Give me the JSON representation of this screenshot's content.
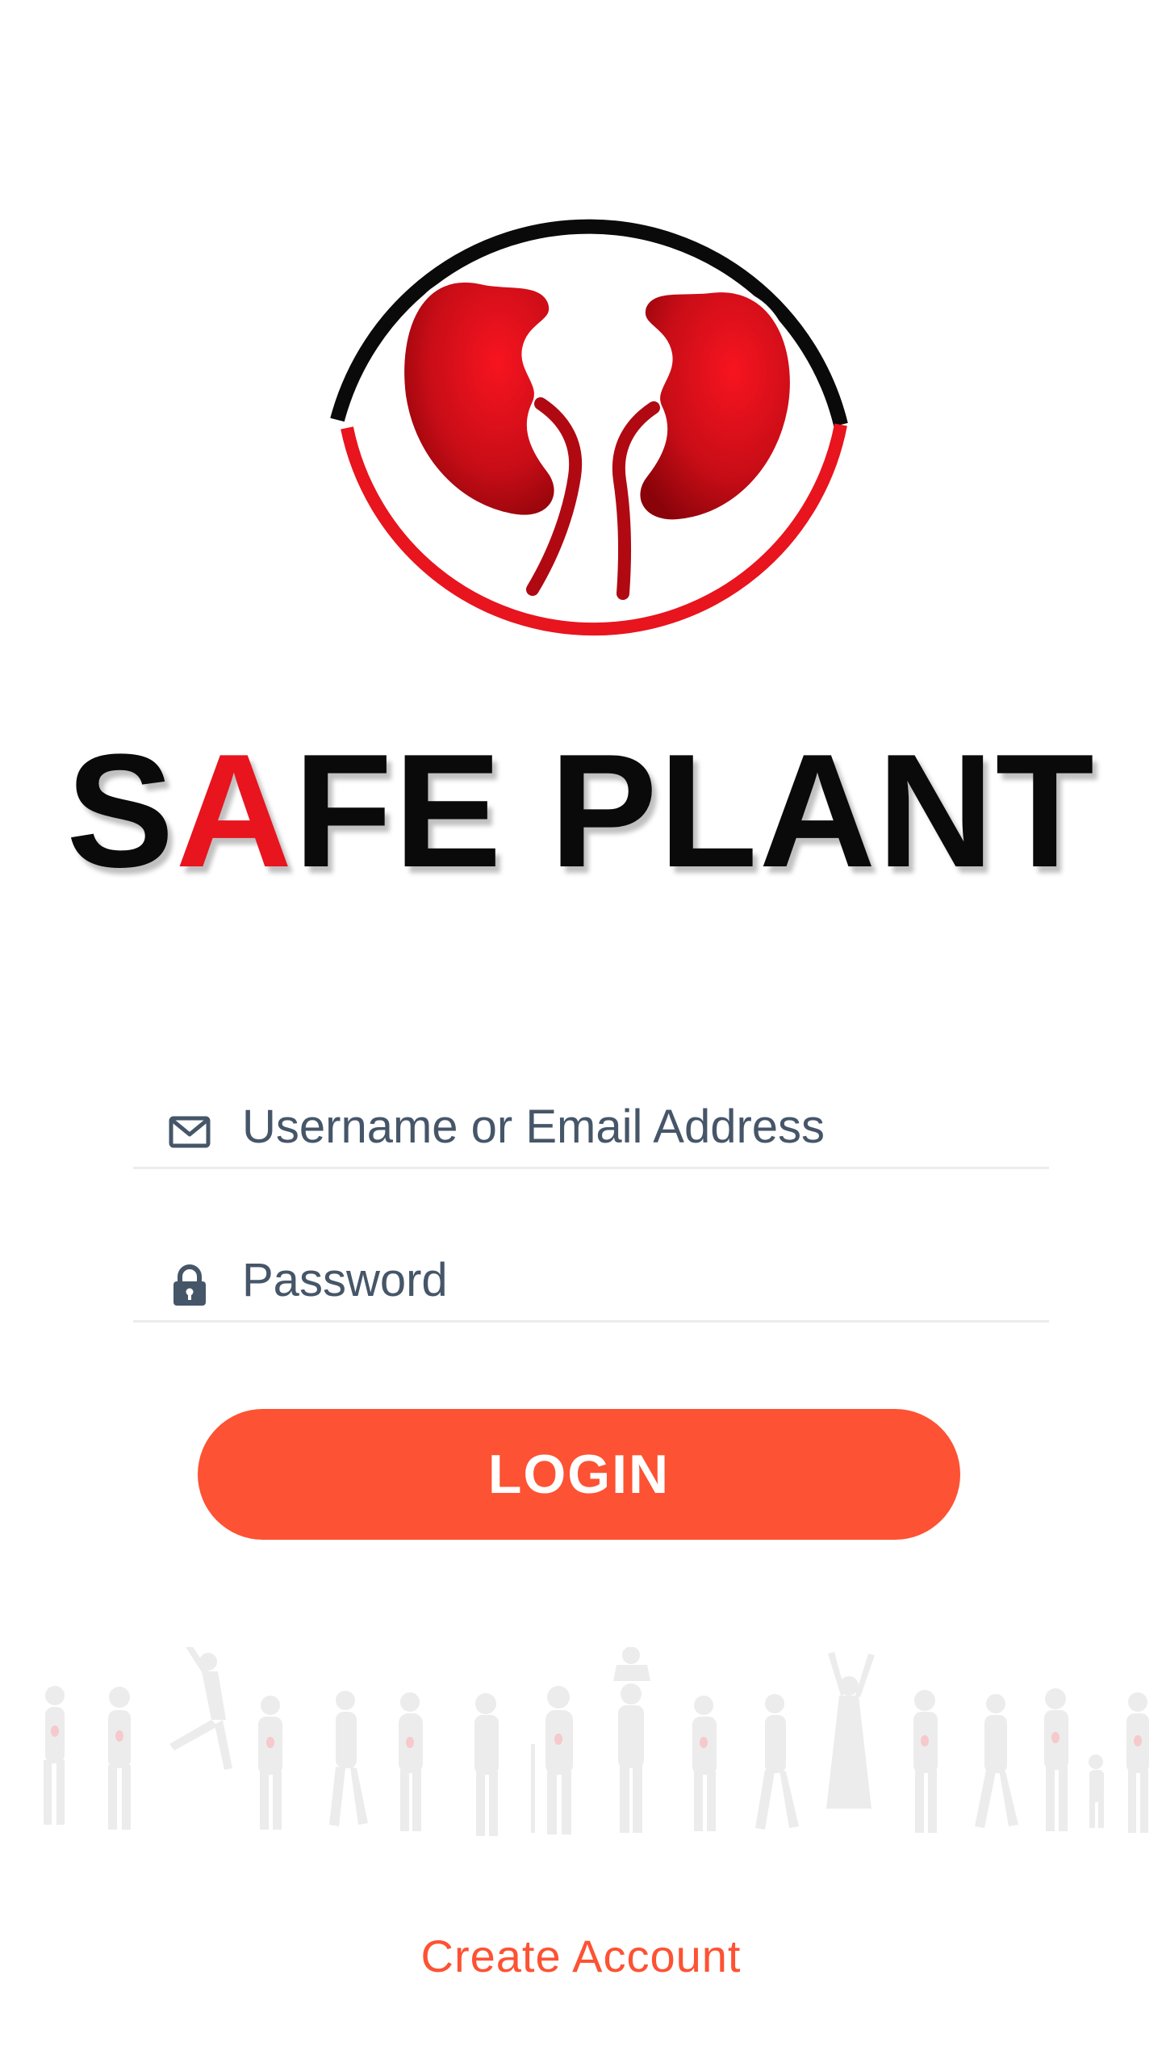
{
  "brand": {
    "name_part1": "S",
    "name_accent": "A",
    "name_part2": "FE PLANT",
    "accent_color": "#e8141e"
  },
  "form": {
    "email": {
      "icon": "envelope-icon",
      "placeholder": "Username or Email Address",
      "value": ""
    },
    "password": {
      "icon": "lock-icon",
      "placeholder": "Password",
      "value": ""
    },
    "login_label": "LOGIN",
    "login_color": "#fd5233"
  },
  "footer": {
    "create_account_label": "Create Account"
  }
}
